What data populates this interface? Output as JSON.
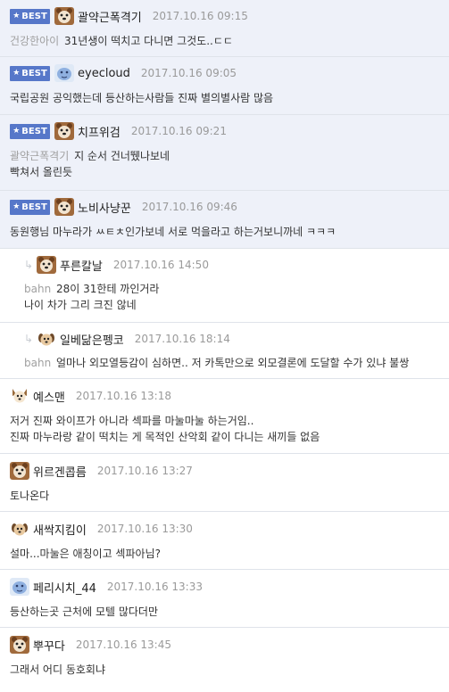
{
  "best_label": "BEST",
  "comments": [
    {
      "nick": "괄약근폭격기",
      "date": "2017.10.16 09:15",
      "mention": "건강한아이",
      "text": "31년생이 떡치고 다니면 그것도..ㄷㄷ"
    },
    {
      "nick": "eyecloud",
      "date": "2017.10.16 09:05",
      "text": "국립공원 공익했는데 등산하는사람들 진짜 별의별사람 많음"
    },
    {
      "nick": "치프위검",
      "date": "2017.10.16 09:21",
      "mention": "괄약근폭격기",
      "text": "지 순서 건너뛨나보네",
      "text2": "빡쳐서 올린듯"
    },
    {
      "nick": "노비사냥꾼",
      "date": "2017.10.16 09:46",
      "text": "동원행님 마누라가 ㅆㅌㅊ인가보네 서로 먹을라고 하는거보니까네 ㅋㅋㅋ"
    },
    {
      "nick": "푸른칼날",
      "date": "2017.10.16 14:50",
      "mention": "bahn",
      "text": "28이 31한테 까인거라",
      "text2": "나이 차가 그리 크진 않네"
    },
    {
      "nick": "일베닮은펭코",
      "date": "2017.10.16 18:14",
      "mention": "bahn",
      "text": "얼마나 외모열등감이 심하면.. 저 카톡만으로 외모결론에 도달할 수가 있냐 불쌍"
    },
    {
      "nick": "예스맨",
      "date": "2017.10.16 13:18",
      "text": "저거 진짜 와이프가 아니라 섹파를 마눌마눌 하는거임..",
      "text2": "진짜 마누라랑 같이 떡치는 게 목적인 산악회 같이 다니는 새끼들 없음"
    },
    {
      "nick": "위르겐콥름",
      "date": "2017.10.16 13:27",
      "text": "토나온다"
    },
    {
      "nick": "새싹지킴이",
      "date": "2017.10.16 13:30",
      "text": "설마...마눌은 애칭이고 섹파아님?"
    },
    {
      "nick": "페리시치_44",
      "date": "2017.10.16 13:33",
      "text": "등산하는곳 근처에 모텔 많다더만"
    },
    {
      "nick": "뿌꾸다",
      "date": "2017.10.16 13:45",
      "text": "그래서 어디 동호회냐"
    }
  ],
  "colors": {
    "best_bg": "#eef1f9",
    "badge": "#5677c9",
    "divider": "#dfe3ea",
    "date": "#9a9a9a",
    "mention": "#a0a0a0"
  },
  "icons": {
    "badge": "star-icon",
    "reply": "reply-arrow-icon",
    "avatar_bear": "bear-avatar-icon",
    "avatar_cloud": "cloud-avatar-icon",
    "avatar_dog": "dog-avatar-icon",
    "avatar_puppy": "puppy-avatar-icon"
  }
}
